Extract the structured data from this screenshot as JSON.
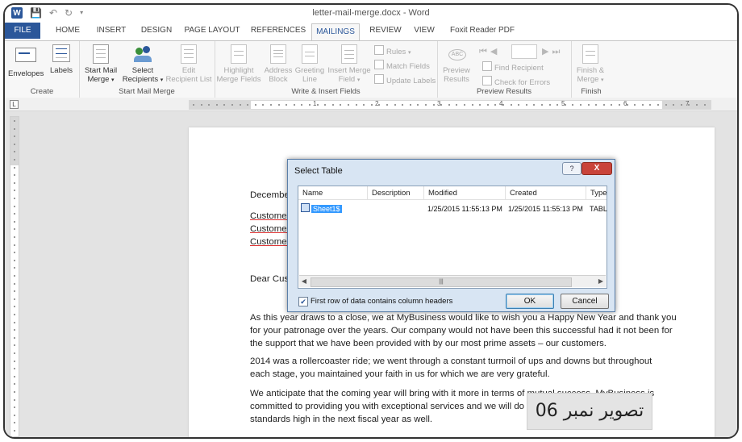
{
  "titlebar": {
    "title": "letter-mail-merge.docx - Word"
  },
  "tabs": [
    "FILE",
    "HOME",
    "INSERT",
    "DESIGN",
    "PAGE LAYOUT",
    "REFERENCES",
    "MAILINGS",
    "REVIEW",
    "VIEW",
    "Foxit Reader PDF"
  ],
  "active_tab": "MAILINGS",
  "ribbon": {
    "create": {
      "label": "Create",
      "envelopes": "Envelopes",
      "labels": "Labels"
    },
    "start_mail_merge": {
      "label": "Start Mail Merge",
      "start_line1": "Start Mail",
      "start_line2": "Merge",
      "select_line1": "Select",
      "select_line2": "Recipients",
      "edit_line1": "Edit",
      "edit_line2": "Recipient List"
    },
    "write_insert": {
      "label": "Write & Insert Fields",
      "highlight_line1": "Highlight",
      "highlight_line2": "Merge Fields",
      "address_line1": "Address",
      "address_line2": "Block",
      "greeting_line1": "Greeting",
      "greeting_line2": "Line",
      "insert_line1": "Insert Merge",
      "insert_line2": "Field",
      "rules": "Rules",
      "match_fields": "Match Fields",
      "update_labels": "Update Labels"
    },
    "preview": {
      "label": "Preview Results",
      "preview_line1": "Preview",
      "preview_line2": "Results",
      "find_recipient": "Find Recipient",
      "check_errors": "Check for Errors"
    },
    "finish": {
      "label": "Finish",
      "finish_line1": "Finish &",
      "finish_line2": "Merge"
    }
  },
  "ruler_numbers": [
    "1",
    "2",
    "3",
    "4",
    "5",
    "6",
    "7"
  ],
  "document": {
    "date": "Decembe",
    "customer1": "Customer",
    "customer2": "Customer",
    "customer3": "Customer",
    "dear": "Dear Cust",
    "p1_l1": "As this year draws to a close, we at MyBusiness would like to wish you a Happy New Year and thank you",
    "p1_l2": "for your patronage over the years. Our company would not have been this successful had it not been for",
    "p1_l3": "the support that we have been provided with by our most prime assets – our customers.",
    "p2_l1": "2014 was a rollercoaster ride; we went through a constant turmoil of ups and downs but throughout",
    "p2_l2": "each stage, you maintained your faith in us for which we are very grateful.",
    "p3_l1": "We anticipate that the coming year will bring with it more in terms of mutual success. MyBusiness is",
    "p3_l2": "committed to providing you with exceptional services and we will do our",
    "p3_l3": "standards high in the next fiscal year as well."
  },
  "dialog": {
    "title": "Select Table",
    "help": "?",
    "close": "X",
    "columns": [
      "Name",
      "Description",
      "Modified",
      "Created",
      "Type"
    ],
    "rows": [
      {
        "name": "Sheet1$",
        "description": "",
        "modified": "1/25/2015 11:55:13 PM",
        "created": "1/25/2015 11:55:13 PM",
        "type": "TABL"
      }
    ],
    "checkbox_label": "First row of data contains column headers",
    "checkbox_checked": true,
    "ok": "OK",
    "cancel": "Cancel"
  },
  "caption": "تصویر نمبر 06"
}
